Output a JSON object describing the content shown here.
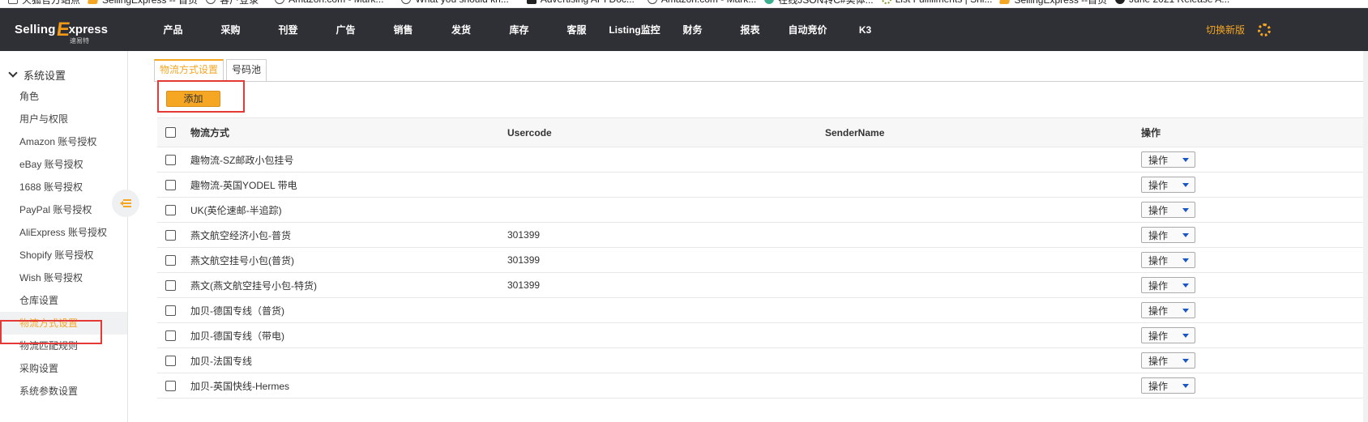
{
  "bookmarks": [
    {
      "icon": "folder-icon",
      "label": "火狐官方站点"
    },
    {
      "icon": "sellingexpress-icon",
      "label": "SellingExpress -- 首页"
    },
    {
      "icon": "globe-icon",
      "label": "客户登录"
    },
    {
      "icon": "globe-icon",
      "label": "Amazon.com - Mark..."
    },
    {
      "icon": "globe-icon",
      "label": "What you should kn..."
    },
    {
      "icon": "advertising-icon",
      "label": "Advertising API Doc..."
    },
    {
      "icon": "globe-icon",
      "label": "Amazon.com - Mark..."
    },
    {
      "icon": "json-icon",
      "label": "在线JSON转C#实体..."
    },
    {
      "icon": "gear-icon",
      "label": "List Fulfillments | Shi..."
    },
    {
      "icon": "sellingexpress-icon",
      "label": "SellingExpress --首页"
    },
    {
      "icon": "github-icon",
      "label": "June 2021 Release A..."
    }
  ],
  "logo": {
    "part1": "Selling",
    "x": "E",
    "part2": "xpress",
    "sub": "速易特"
  },
  "nav": [
    {
      "label": "产品",
      "width": 71
    },
    {
      "label": "采购",
      "width": 71
    },
    {
      "label": "刊登",
      "width": 71
    },
    {
      "label": "广告",
      "width": 71
    },
    {
      "label": "销售",
      "width": 71
    },
    {
      "label": "发货",
      "width": 72
    },
    {
      "label": "库存",
      "width": 71
    },
    {
      "label": "客服",
      "width": 71
    },
    {
      "label": "Listing监控",
      "width": 72
    },
    {
      "label": "财务",
      "width": 71
    },
    {
      "label": "报表",
      "width": 71
    },
    {
      "label": "自动竞价",
      "width": 71
    },
    {
      "label": "K3",
      "width": 71
    }
  ],
  "header_right": {
    "switch_label": "切换新版",
    "settings_icon": "gear-icon"
  },
  "sidebar": {
    "group_label": "系统设置",
    "items": [
      {
        "label": "角色",
        "active": false
      },
      {
        "label": "用户与权限",
        "active": false
      },
      {
        "label": "Amazon 账号授权",
        "active": false
      },
      {
        "label": "eBay 账号授权",
        "active": false
      },
      {
        "label": "1688 账号授权",
        "active": false
      },
      {
        "label": "PayPal 账号授权",
        "active": false
      },
      {
        "label": "AliExpress 账号授权",
        "active": false
      },
      {
        "label": "Shopify 账号授权",
        "active": false
      },
      {
        "label": "Wish 账号授权",
        "active": false
      },
      {
        "label": "仓库设置",
        "active": false
      },
      {
        "label": "物流方式设置",
        "active": true
      },
      {
        "label": "物流匹配规则",
        "active": false
      },
      {
        "label": "采购设置",
        "active": false
      },
      {
        "label": "系统参数设置",
        "active": false
      }
    ]
  },
  "tabs": [
    {
      "label": "物流方式设置",
      "active": true
    },
    {
      "label": "号码池",
      "active": false
    }
  ],
  "toolbar": {
    "add_label": "添加"
  },
  "table": {
    "headers": {
      "name": "物流方式",
      "usercode": "Usercode",
      "sender": "SenderName",
      "op": "操作"
    },
    "op_label": "操作",
    "rows": [
      {
        "name": "趣物流-SZ邮政小包挂号",
        "usercode": "",
        "sender": ""
      },
      {
        "name": "趣物流-英国YODEL 带电",
        "usercode": "",
        "sender": ""
      },
      {
        "name": "UK(英伦速邮-半追踪)",
        "usercode": "",
        "sender": ""
      },
      {
        "name": "燕文航空经济小包-普货",
        "usercode": "301399",
        "sender": ""
      },
      {
        "name": "燕文航空挂号小包(普货)",
        "usercode": "301399",
        "sender": ""
      },
      {
        "name": "燕文(燕文航空挂号小包-特货)",
        "usercode": "301399",
        "sender": ""
      },
      {
        "name": "加贝-德国专线（普货)",
        "usercode": "",
        "sender": ""
      },
      {
        "name": "加贝-德国专线（带电)",
        "usercode": "",
        "sender": ""
      },
      {
        "name": "加贝-法国专线",
        "usercode": "",
        "sender": ""
      },
      {
        "name": "加贝-英国快线-Hermes",
        "usercode": "",
        "sender": ""
      }
    ]
  },
  "colors": {
    "accent": "#f5a623",
    "nav_bg": "#2f3035",
    "highlight_box": "#e53935",
    "caret": "#1a56c4"
  }
}
